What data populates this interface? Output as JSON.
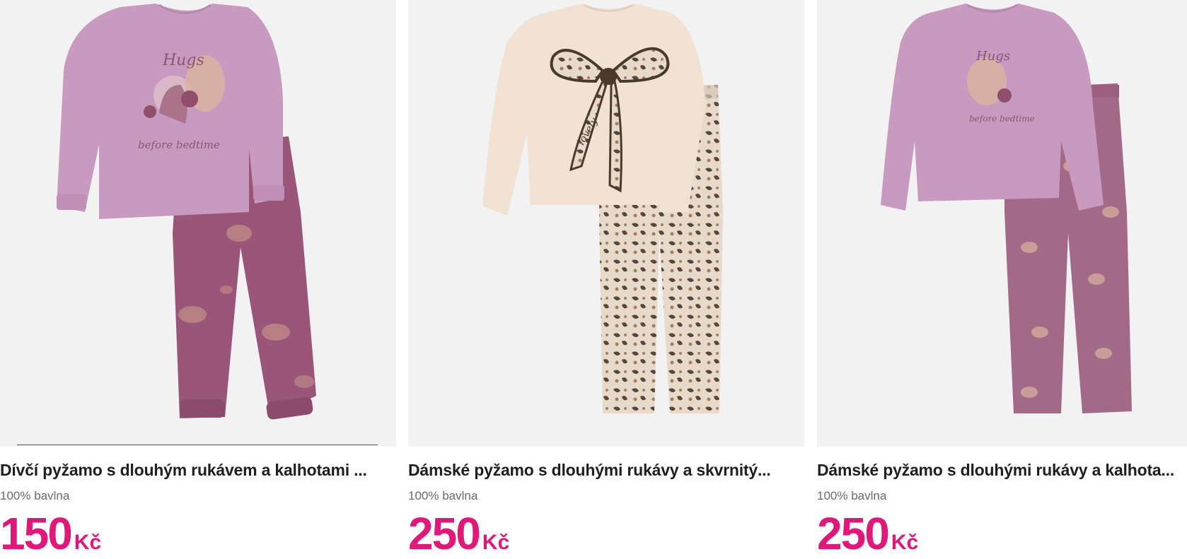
{
  "colors": {
    "price": "#e0187a",
    "title": "#1f1f1f",
    "subtitle": "#6b6b6b",
    "image_background": "#f2f2f2"
  },
  "products": [
    {
      "title": "Dívčí pyžamo s dlouhým rukávem a kalhotami ...",
      "material": "100% bavlna",
      "price": "150",
      "currency": "Kč",
      "image": "lilac-pajama-squirrel-print"
    },
    {
      "title": "Dámské pyžamo s dlouhými rukávy a skvrnitý...",
      "material": "100% bavlna",
      "price": "250",
      "currency": "Kč",
      "image": "cream-pajama-leopard-bow"
    },
    {
      "title": "Dámské pyžamo s dlouhými rukávy a kalhota...",
      "material": "100% bavlna",
      "price": "250",
      "currency": "Kč",
      "image": "lilac-pajama-squirrel-print"
    }
  ]
}
